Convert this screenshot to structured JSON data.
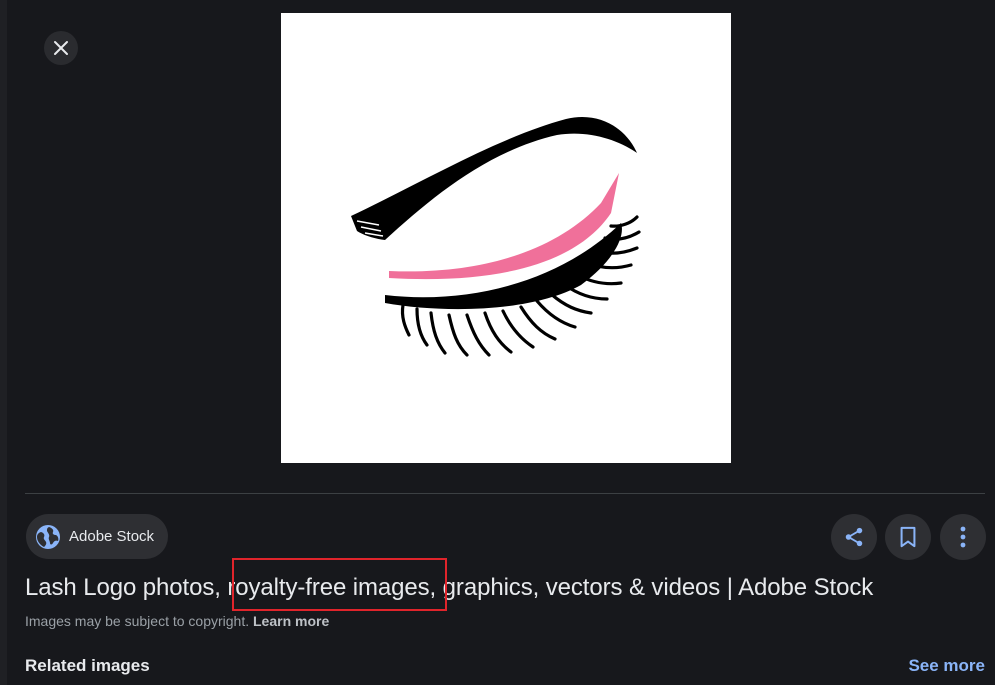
{
  "viewer": {
    "close_icon": "close-icon",
    "image_alt": "Lash logo illustration: black eyebrow, pink eyeliner stroke and black eyelashes",
    "colors": {
      "eyebrow": "#000000",
      "liner": "#f0709a",
      "lashes": "#000000"
    }
  },
  "source": {
    "name": "Adobe Stock",
    "icon": "globe-icon",
    "icon_color": "#8ab4f8"
  },
  "actions": [
    {
      "name": "share",
      "icon": "share-icon"
    },
    {
      "name": "save",
      "icon": "bookmark-icon"
    },
    {
      "name": "more",
      "icon": "more-vert-icon"
    }
  ],
  "result": {
    "title_pre": "Lash Logo photos, ",
    "title_highlight": "royalty-free images",
    "title_post": ", graphics, vectors & videos | Adobe Stock",
    "highlight_color": "#e0242b"
  },
  "copyright": {
    "text": "Images may be subject to copyright.",
    "link": "Learn more"
  },
  "related": {
    "heading": "Related images",
    "see_more": "See more"
  }
}
